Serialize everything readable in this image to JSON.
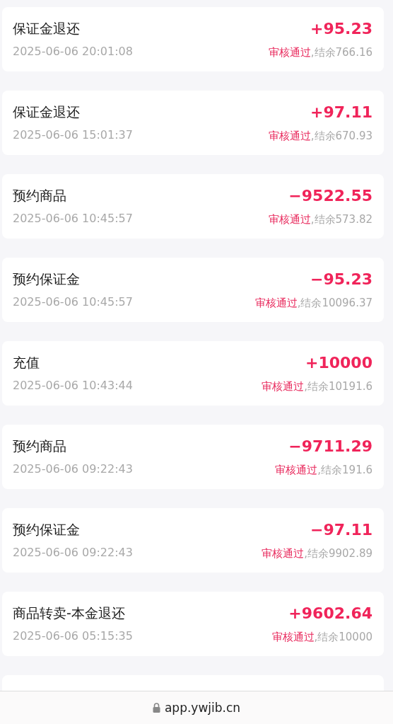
{
  "transactions": [
    {
      "title": "保证金退还",
      "time": "2025-06-06 20:01:08",
      "amount": "+95.23",
      "status": "审核通过",
      "balance": ",结余766.16"
    },
    {
      "title": "保证金退还",
      "time": "2025-06-06 15:01:37",
      "amount": "+97.11",
      "status": "审核通过",
      "balance": ",结余670.93"
    },
    {
      "title": "预约商品",
      "time": "2025-06-06 10:45:57",
      "amount": "−9522.55",
      "status": "审核通过",
      "balance": ",结余573.82"
    },
    {
      "title": "预约保证金",
      "time": "2025-06-06 10:45:57",
      "amount": "−95.23",
      "status": "审核通过",
      "balance": ",结余10096.37"
    },
    {
      "title": "充值",
      "time": "2025-06-06 10:43:44",
      "amount": "+10000",
      "status": "审核通过",
      "balance": ",结余10191.6"
    },
    {
      "title": "预约商品",
      "time": "2025-06-06 09:22:43",
      "amount": "−9711.29",
      "status": "审核通过",
      "balance": ",结余191.6"
    },
    {
      "title": "预约保证金",
      "time": "2025-06-06 09:22:43",
      "amount": "−97.11",
      "status": "审核通过",
      "balance": ",结余9902.89"
    },
    {
      "title": "商品转卖-本金退还",
      "time": "2025-06-06 05:15:35",
      "amount": "+9602.64",
      "status": "审核通过",
      "balance": ",结余10000"
    }
  ],
  "address_bar": {
    "url": "app.ywjib.cn",
    "secure": true
  }
}
